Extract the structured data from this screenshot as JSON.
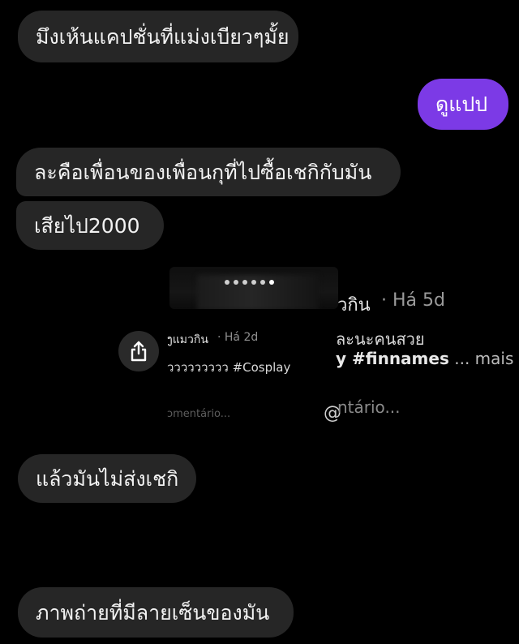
{
  "messages": [
    {
      "id": "m1",
      "sender": "other",
      "text": "มึงเห้นแคปชั่นที่แม่งเบียวๆมั้ย"
    },
    {
      "id": "m2",
      "sender": "me",
      "text": "ดูแปป"
    },
    {
      "id": "m3",
      "sender": "other",
      "text": "ละคือเพื่อนของเพื่อนกุที่ไปซื้อเชกิกับมัน"
    },
    {
      "id": "m4",
      "sender": "other",
      "text": "เสียไป2000"
    },
    {
      "id": "m5",
      "sender": "other",
      "text": "แล้วมันไม่ส่งเชกิ"
    },
    {
      "id": "m6",
      "sender": "other",
      "text": "ภาพถ่ายที่มีลายเซ็นของมัน"
    }
  ],
  "shared_post": {
    "author_large": "วกิน",
    "time_large": "· Há 5d",
    "caption_thai_large": "ละนะคนสวย",
    "caption_large": "y #finnames",
    "more_label": "... mais",
    "comment_large": "ntário...",
    "author_small": "ງแมวกิน",
    "time_small": "· Há 2d",
    "caption_small": "ววววววววว #Cosplay",
    "comment_small": "ɔmentário...",
    "carousel_dots": 6
  },
  "icons": {
    "share": "share-icon",
    "mention": "at-sign-icon"
  },
  "colors": {
    "background": "#000000",
    "bubble_other": "#262626",
    "bubble_me": "#7c3ae6"
  }
}
